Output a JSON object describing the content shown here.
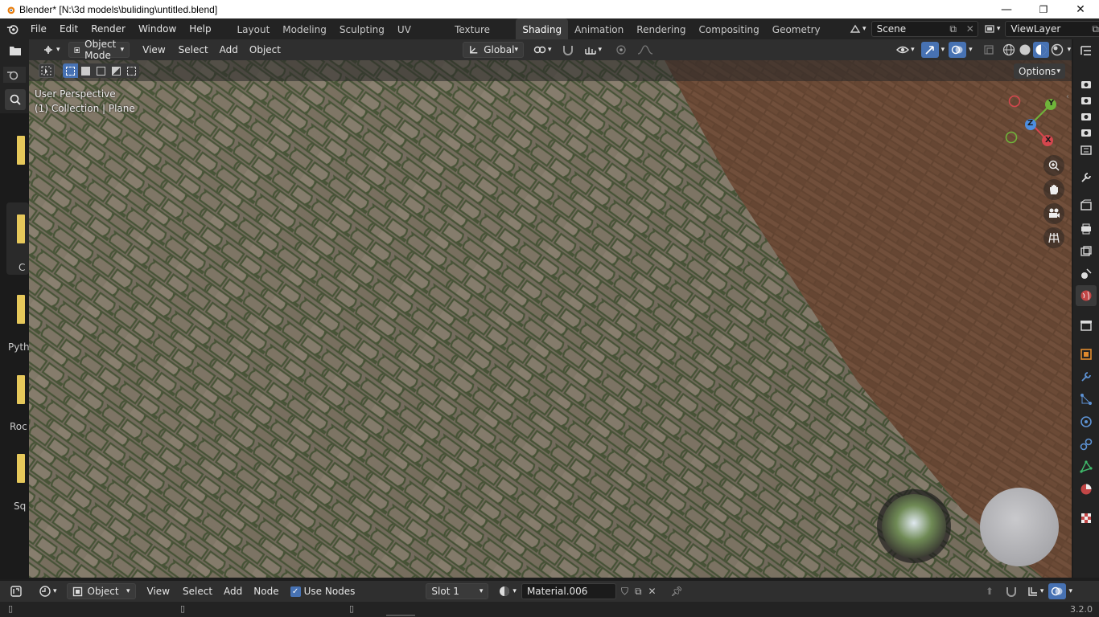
{
  "window": {
    "title": "Blender* [N:\\3d models\\buliding\\untitled.blend]",
    "minimize": "—",
    "maximize": "❐",
    "close": "✕"
  },
  "menu": {
    "items": [
      "File",
      "Edit",
      "Render",
      "Window",
      "Help"
    ]
  },
  "workspaces": {
    "tabs": [
      "Layout",
      "Modeling",
      "Sculpting",
      "UV Editing",
      "Texture Paint",
      "Shading",
      "Animation",
      "Rendering",
      "Compositing",
      "Geometry Noc"
    ],
    "active": "Shading"
  },
  "scene": {
    "name": "Scene"
  },
  "view_layer": {
    "name": "ViewLayer"
  },
  "viewport_header": {
    "mode": "Object Mode",
    "view": "View",
    "select": "Select",
    "add": "Add",
    "object": "Object",
    "transform_orientation": "Global",
    "options": "Options"
  },
  "viewport": {
    "perspective_label": "User Perspective",
    "collection_label": "(1) Collection | Plane",
    "gizmo_y": "Y",
    "gizmo_z": "Z",
    "gizmo_x": "X"
  },
  "left_panel_labels": [
    "C",
    "Pyth",
    "Roc",
    "Sq"
  ],
  "node_header": {
    "mode": "Object",
    "view": "View",
    "select": "Select",
    "add": "Add",
    "node": "Node",
    "use_nodes": "Use Nodes",
    "use_nodes_checked": true,
    "slot": "Slot 1",
    "material": "Material.006"
  },
  "status": {
    "version": "3.2.0"
  },
  "colors": {
    "accent": "#4772b3",
    "header_bg": "#2f2f2f",
    "bar_bg": "#232323"
  }
}
